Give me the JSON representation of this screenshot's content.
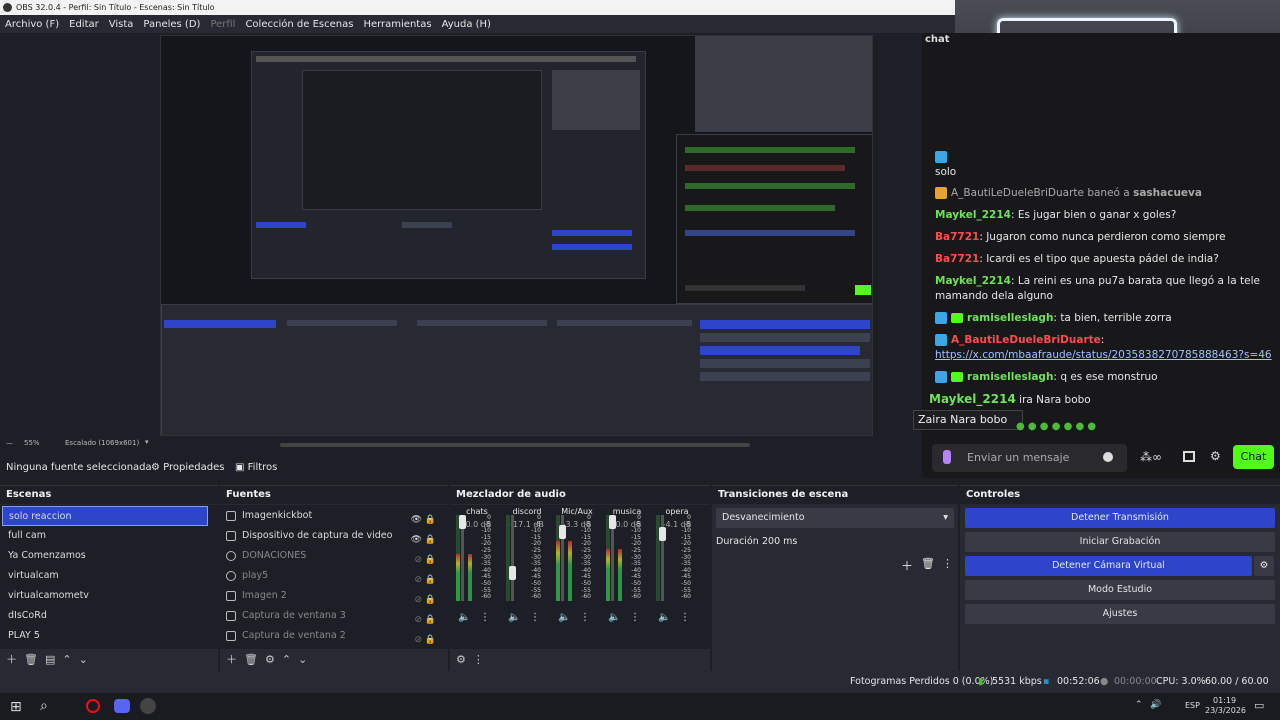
{
  "window": {
    "title": "OBS 32.0.4 - Perfil: Sin Título - Escenas: Sin Título"
  },
  "menu": [
    "Archivo (F)",
    "Editar",
    "Vista",
    "Paneles (D)",
    "Perfil",
    "Colección de Escenas",
    "Herramientas",
    "Ayuda (H)"
  ],
  "preview": {
    "zoom": "55%",
    "scale": "Escalado (1069x601)"
  },
  "source_bar": {
    "selected": "Ninguna fuente seleccionada",
    "properties": "Propiedades",
    "filters": "Filtros"
  },
  "chat": {
    "tab": "chat",
    "messages": [
      {
        "user": "",
        "text": "solo",
        "kind": "plain"
      },
      {
        "user": "A_BautiLeDueleBriDuarte",
        "text": "baneó a",
        "target": "sashacueva",
        "kind": "ban"
      },
      {
        "user": "Maykel_2214",
        "text": "Es jugar bien o ganar x goles?",
        "kind": "green"
      },
      {
        "user": "Ba7721",
        "text": "Jugaron como nunca perdieron como siempre",
        "kind": "red"
      },
      {
        "user": "Ba7721",
        "text": "Icardi es el tipo que apuesta pádel de india?",
        "kind": "red"
      },
      {
        "user": "Maykel_2214",
        "text": "La reini es una pu7a barata que llegó a la tele mamando dela alguno",
        "kind": "green"
      },
      {
        "user": "ramiselleslagh",
        "text": "ta bien, terrible zorra",
        "kind": "bot"
      },
      {
        "user": "A_BautiLeDueleBriDuarte",
        "text": "https://x.com/mbaafraude/status/2035838270785888463?s=46",
        "kind": "redlink"
      },
      {
        "user": "ramiselleslagh",
        "text": "q es ese monstruo",
        "kind": "bot"
      }
    ],
    "overlay_user": "Maykel_2214",
    "overlay_text": "ira Nara bobo",
    "tooltip": "Zaira Nara bobo",
    "input_placeholder": "Enviar un mensaje",
    "send_label": "Chat"
  },
  "scenes": {
    "title": "Escenas",
    "items": [
      "solo reaccion",
      "full cam",
      "Ya Comenzamos",
      "virtualcam",
      "virtualcamometv",
      "dIsCoRd",
      "PLAY 5"
    ],
    "selected_index": 0
  },
  "sources": {
    "title": "Fuentes",
    "items": [
      {
        "name": "Imagenkickbot",
        "visible": true
      },
      {
        "name": "Dispositivo de captura de video",
        "visible": true
      },
      {
        "name": "DONACIONES",
        "visible": false
      },
      {
        "name": "play5",
        "visible": false
      },
      {
        "name": "Imagen 2",
        "visible": false
      },
      {
        "name": "Captura de ventana 3",
        "visible": false
      },
      {
        "name": "Captura de ventana 2",
        "visible": false
      }
    ]
  },
  "mixer": {
    "title": "Mezclador de audio",
    "channels": [
      {
        "name": "chats",
        "db": "-0.0 dB",
        "level": 0.55
      },
      {
        "name": "discord",
        "db": "-17.1 dB",
        "level": 0.0
      },
      {
        "name": "Mic/Aux",
        "db": "-3.3 dB",
        "level": 0.7
      },
      {
        "name": "musica",
        "db": "-0.0 dB",
        "level": 0.6
      },
      {
        "name": "opera",
        "db": "-4.1 dB",
        "level": 0.0
      }
    ],
    "scale": [
      "0",
      "-5",
      "-10",
      "-15",
      "-20",
      "-25",
      "-30",
      "-35",
      "-40",
      "-45",
      "-50",
      "-55",
      "-60"
    ]
  },
  "transitions": {
    "title": "Transiciones de escena",
    "selected": "Desvanecimiento",
    "duration_label": "Duración",
    "duration": "200 ms"
  },
  "controls": {
    "title": "Controles",
    "buttons": [
      "Detener Transmisión",
      "Iniciar Grabación",
      "Detener Cámara Virtual",
      "Modo Estudio",
      "Ajustes"
    ]
  },
  "status": {
    "dropped": "Fotogramas Perdidos 0 (0.0%)",
    "bitrate": "5531 kbps",
    "stream_time": "00:52:06",
    "rec_time": "00:00:00",
    "cpu": "CPU: 3.0%",
    "fps": "60.00 / 60.00 FPS"
  },
  "taskbar": {
    "lang": "ESP",
    "time": "01:19",
    "date": "23/3/2026"
  },
  "colors": {
    "accent": "#2c45c9",
    "kick_green": "#53fc18",
    "panel": "#272a33",
    "bg": "#1d1f26"
  }
}
